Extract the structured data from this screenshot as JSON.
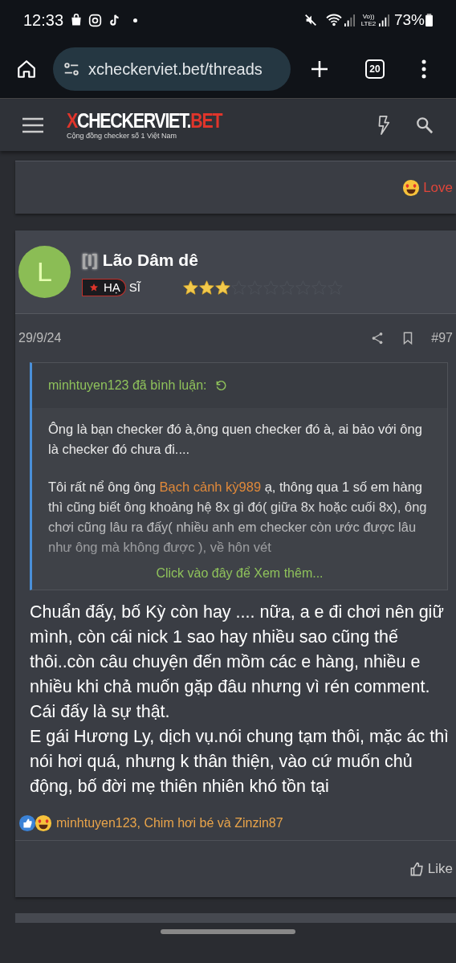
{
  "status_bar": {
    "time": "12:33",
    "battery": "73%",
    "network_label": "Vo)) LTE2"
  },
  "browser": {
    "url": "xcheckerviet.bet/threads",
    "tab_count": "20"
  },
  "site_header": {
    "logo_prefix": "X",
    "logo_main": "CHECKERVIET.",
    "logo_suffix": "BET",
    "tagline": "Cộng đồng checker số 1 Việt Nam"
  },
  "previous_post": {
    "reaction": "Love"
  },
  "post": {
    "avatar_letter": "L",
    "username_prefix": "[I]",
    "username": "Lão Dâm dê",
    "rank_badge": "HẠ",
    "rank_text": "SĨ",
    "stars": 3,
    "date": "29/9/24",
    "post_number": "#97",
    "quote": {
      "author_line": "minhtuyen123 đã bình luận:",
      "paragraphs": [
        {
          "before": "Ông là bạn checker đó à,ông quen checker đó à, ai bảo với ông là checker đó chưa đi...."
        },
        {
          "before": "Tôi rất nể ông ông ",
          "link": "Bạch cảnh kỳ989",
          "after": " ạ, thông qua 1 số em hàng thì cũng biết ông khoảng hệ 8x gì đó( giữa 8x hoặc cuối 8x), ông chơi cũng lâu ra đấy( nhiều anh em checker còn ước được lâu như ông mà không được ), về hôn vét"
        }
      ],
      "expand_link": "Click vào đây để Xem thêm..."
    },
    "body": [
      "Chuẩn đấy, bố Kỳ còn hay .... nữa, a e đi chơi nên giữ mình, còn cái nick 1 sao hay nhiều sao cũng thế thôi..còn câu chuyện đến mồm các e hàng, nhiều e nhiều khi chả muốn gặp đâu nhưng vì rén comment. Cái đấy là sự thật.",
      "E gái Hương Ly, dịch vụ.nói chung tạm thôi, mặc ác thì nói hơi quá, nhưng k thân thiện, vào cứ muốn chủ động, bố đời mẹ thiên nhiên khó tồn tại"
    ],
    "reactions_line": "minhtuyen123, Chim hơi bé và Zinzin87",
    "like_button": "Like"
  }
}
